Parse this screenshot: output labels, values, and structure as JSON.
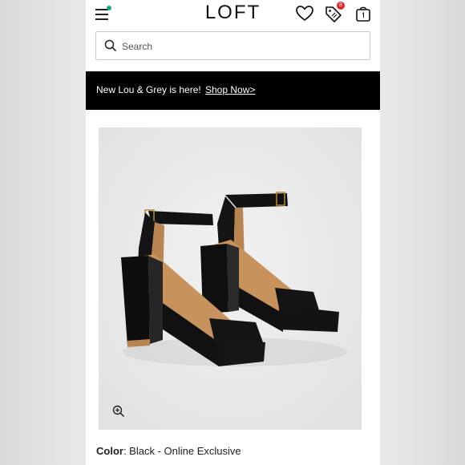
{
  "header": {
    "logo": "LOFT",
    "bag_badge": "8",
    "icons": [
      "menu-icon",
      "heart-icon",
      "tag-icon",
      "bag-icon"
    ]
  },
  "search": {
    "placeholder": "Search"
  },
  "promo": {
    "text": "New Lou & Grey is here!",
    "link": "Shop Now>"
  },
  "product": {
    "color_label": "Color",
    "color_value": ": Black - Online Exclusive"
  },
  "colors": {
    "accent_dot": "#1fa38a",
    "badge": "#d9262c",
    "promo_bg": "#000000"
  }
}
